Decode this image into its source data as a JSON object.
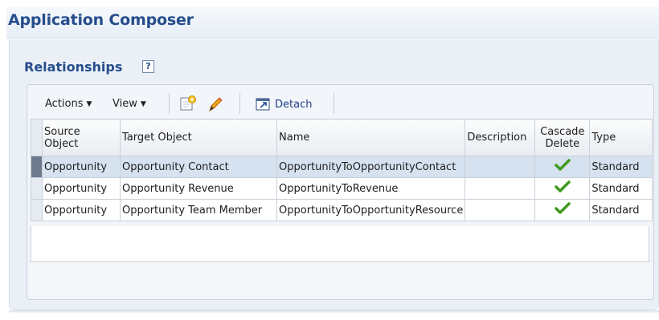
{
  "app": {
    "title": "Application Composer"
  },
  "section": {
    "title": "Relationships",
    "help_glyph": "?"
  },
  "toolbar": {
    "actions_label": "Actions",
    "view_label": "View",
    "create_icon": "create-icon",
    "edit_icon": "edit-pencil-icon",
    "detach_icon": "detach-icon",
    "detach_label": "Detach"
  },
  "table": {
    "columns": {
      "source_object": "Source\nObject",
      "target_object": "Target Object",
      "name": "Name",
      "description": "Description",
      "cascade_delete": "Cascade\nDelete",
      "type": "Type"
    },
    "rows": [
      {
        "source": "Opportunity",
        "target": "Opportunity Contact",
        "name": "OpportunityToOpportunityContact",
        "description": "",
        "cascade_delete": true,
        "type": "Standard",
        "selected": true
      },
      {
        "source": "Opportunity",
        "target": "Opportunity Revenue",
        "name": "OpportunityToRevenue",
        "description": "",
        "cascade_delete": true,
        "type": "Standard",
        "selected": false
      },
      {
        "source": "Opportunity",
        "target": "Opportunity Team Member",
        "name": "OpportunityToOpportunityResource",
        "description": "",
        "cascade_delete": true,
        "type": "Standard",
        "selected": false
      }
    ]
  },
  "colors": {
    "title_blue": "#264d8c",
    "check_green": "#3f9a1e",
    "selected_row": "#d6e2f0"
  }
}
